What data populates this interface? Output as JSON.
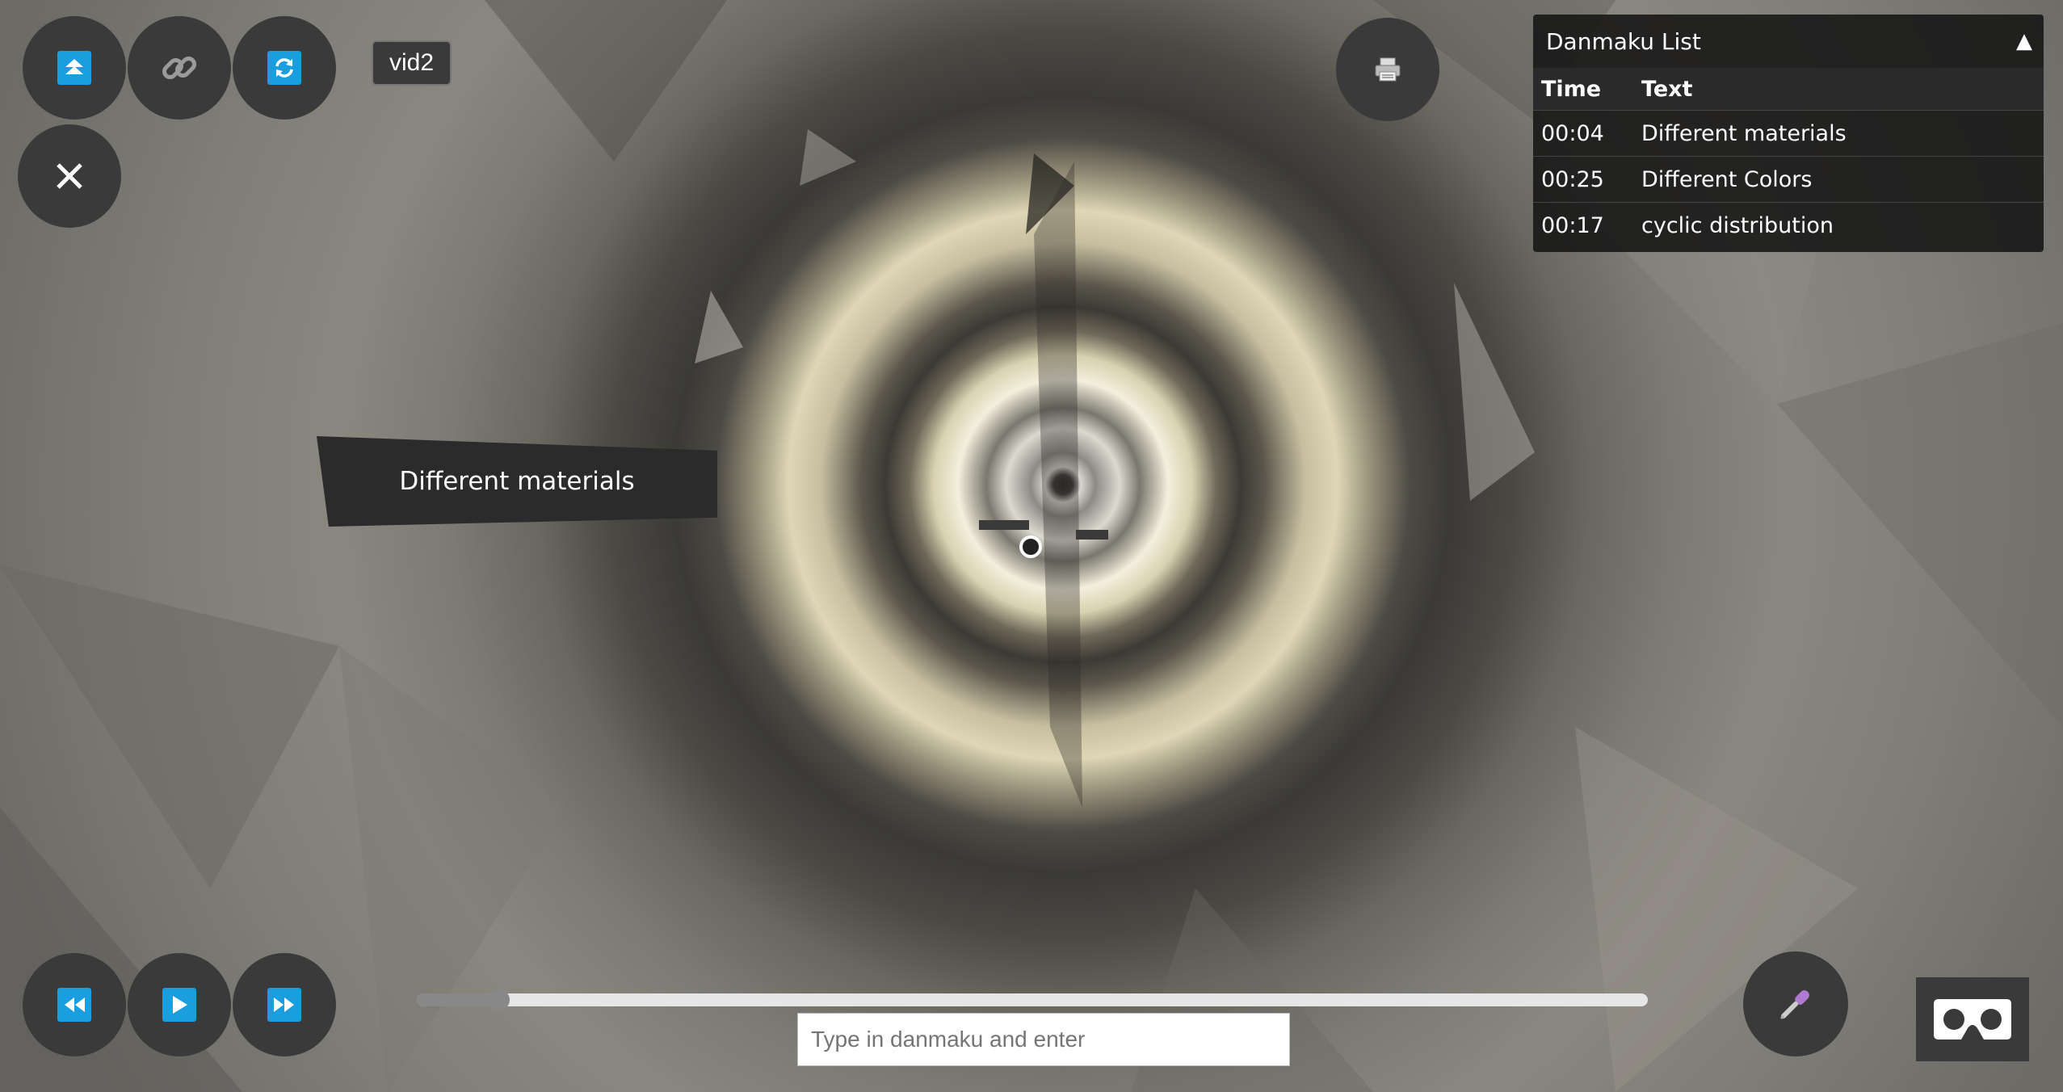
{
  "toolbar": {
    "top_buttons": [
      {
        "name": "upload-button",
        "icon": "eject-up-icon"
      },
      {
        "name": "link-button",
        "icon": "link-icon"
      },
      {
        "name": "refresh-button",
        "icon": "refresh-icon"
      }
    ],
    "close_icon": "close-icon",
    "printer_icon": "printer-icon"
  },
  "video": {
    "label": "vid2"
  },
  "danmaku_panel": {
    "title": "Danmaku List",
    "collapse_glyph": "▲",
    "headers": {
      "time": "Time",
      "text": "Text"
    },
    "rows": [
      {
        "time": "00:04",
        "text": "Different materials"
      },
      {
        "time": "00:25",
        "text": "Different Colors"
      },
      {
        "time": "00:17",
        "text": "cyclic distribution"
      }
    ]
  },
  "floating_danmaku": {
    "text": "Different materials"
  },
  "playback": {
    "buttons": [
      {
        "name": "rewind-button",
        "icon": "rewind-icon"
      },
      {
        "name": "play-button",
        "icon": "play-icon"
      },
      {
        "name": "fast-forward-button",
        "icon": "fast-forward-icon"
      }
    ],
    "progress_fraction": 0.067
  },
  "input": {
    "placeholder": "Type in danmaku and enter",
    "value": ""
  },
  "mic_icon": "microphone-icon",
  "vr_icon": "vr-goggles-icon",
  "colors": {
    "accent": "#1a9ee0",
    "button_bg": "#3a3a3a",
    "panel_bg": "#141414"
  }
}
